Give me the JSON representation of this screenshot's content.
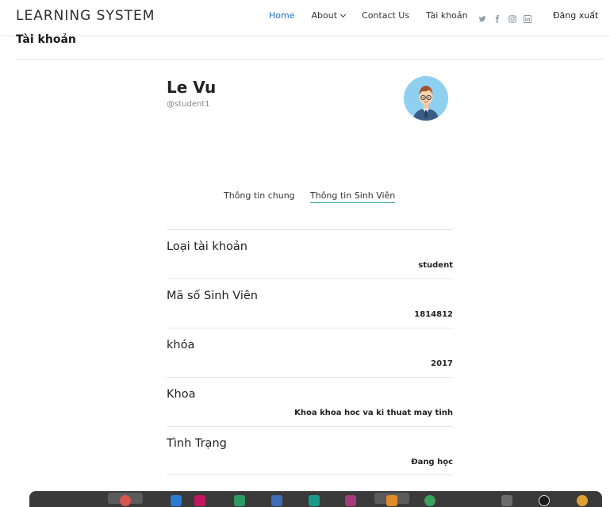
{
  "header": {
    "brand": "LEARNING SYSTEM",
    "nav": [
      {
        "label": "Home",
        "active": true
      },
      {
        "label": "About",
        "dropdown": true
      },
      {
        "label": "Contact Us"
      },
      {
        "label": "Tài khoản"
      }
    ],
    "social_icons": [
      "twitter-icon",
      "facebook-icon",
      "instagram-icon",
      "linkedin-icon"
    ],
    "logout_label": "Đăng xuất",
    "accent_color": "#1e73be"
  },
  "page": {
    "title": "Tài khoản"
  },
  "profile": {
    "name": "Le Vu",
    "handle": "@student1"
  },
  "tabs": [
    {
      "label": "Thông tin chung",
      "active": false
    },
    {
      "label": "Thông tin Sinh Viên",
      "active": true
    }
  ],
  "tab_underline_color": "#2aa39a",
  "fields": [
    {
      "label": "Loại tài khoản",
      "value": "student"
    },
    {
      "label": "Mã số Sinh Viên",
      "value": "1814812"
    },
    {
      "label": "khóa",
      "value": "2017"
    },
    {
      "label": "Khoa",
      "value": "Khoa khoa hoc va ki thuat may tinh"
    },
    {
      "label": "Tình Trạng",
      "value": "Đang học"
    }
  ]
}
